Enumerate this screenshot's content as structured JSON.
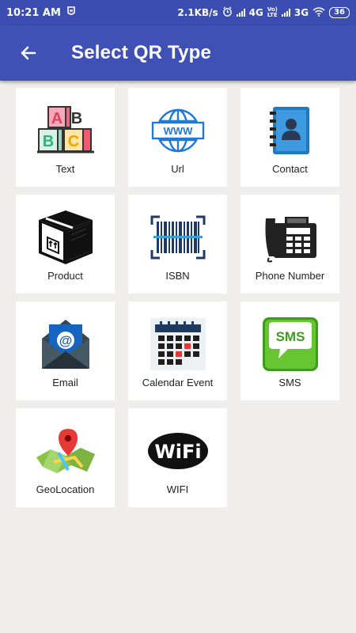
{
  "status_bar": {
    "time": "10:21 AM",
    "net_speed": "2.1KB/s",
    "net1": "4G",
    "volte_top": "Vo)",
    "volte_bottom": "LTE",
    "net2": "3G",
    "battery": "36"
  },
  "app_bar": {
    "title": "Select QR Type",
    "back_icon": "arrow-left-icon"
  },
  "tiles": [
    {
      "label": "Text",
      "icon": "abc-blocks-icon"
    },
    {
      "label": "Url",
      "icon": "globe-www-icon"
    },
    {
      "label": "Contact",
      "icon": "address-book-icon"
    },
    {
      "label": "Product",
      "icon": "package-box-icon"
    },
    {
      "label": "ISBN",
      "icon": "barcode-icon"
    },
    {
      "label": "Phone Number",
      "icon": "desk-phone-icon"
    },
    {
      "label": "Email",
      "icon": "envelope-at-icon"
    },
    {
      "label": "Calendar Event",
      "icon": "calendar-icon"
    },
    {
      "label": "SMS",
      "icon": "sms-bubble-icon"
    },
    {
      "label": "GeoLocation",
      "icon": "map-pin-icon"
    },
    {
      "label": "WIFI",
      "icon": "wifi-logo-icon"
    }
  ],
  "colors": {
    "app_bar": "#3f51b5",
    "status_bar": "#3b4db0",
    "background": "#f0eded"
  }
}
